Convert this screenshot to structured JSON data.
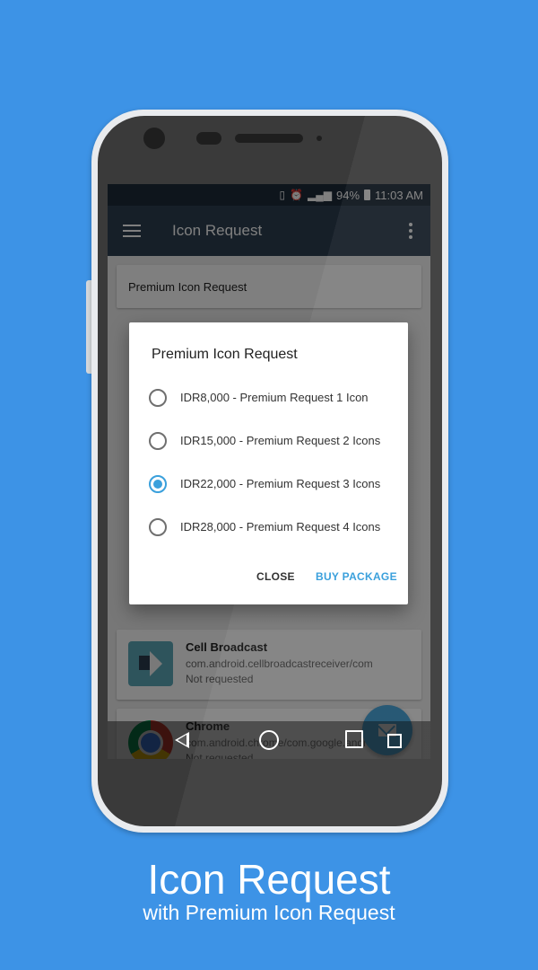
{
  "status_bar": {
    "battery": "94%",
    "time": "11:03 AM"
  },
  "app_bar": {
    "title": "Icon Request"
  },
  "header_card": {
    "title": "Premium Icon Request"
  },
  "list": [
    {
      "name": "Cell Broadcast",
      "package": "com.android.cellbroadcastreceiver/com",
      "status": "Not requested"
    },
    {
      "name": "Chrome",
      "package": "com.android.chrome/com.google.andr",
      "status": "Not requested"
    }
  ],
  "dialog": {
    "title": "Premium Icon Request",
    "options": [
      {
        "label": "IDR8,000 - Premium Request 1 Icon",
        "selected": false
      },
      {
        "label": "IDR15,000 - Premium Request 2 Icons",
        "selected": false
      },
      {
        "label": "IDR22,000 - Premium Request 3 Icons",
        "selected": true
      },
      {
        "label": "IDR28,000 - Premium Request 4 Icons",
        "selected": false
      }
    ],
    "close_label": "CLOSE",
    "buy_label": "BUY PACKAGE"
  },
  "caption": {
    "title": "Icon Request",
    "subtitle": "with Premium Icon Request"
  },
  "colors": {
    "background": "#3d93e6",
    "toolbar": "#2c3e50",
    "accent": "#3aa0dc"
  }
}
